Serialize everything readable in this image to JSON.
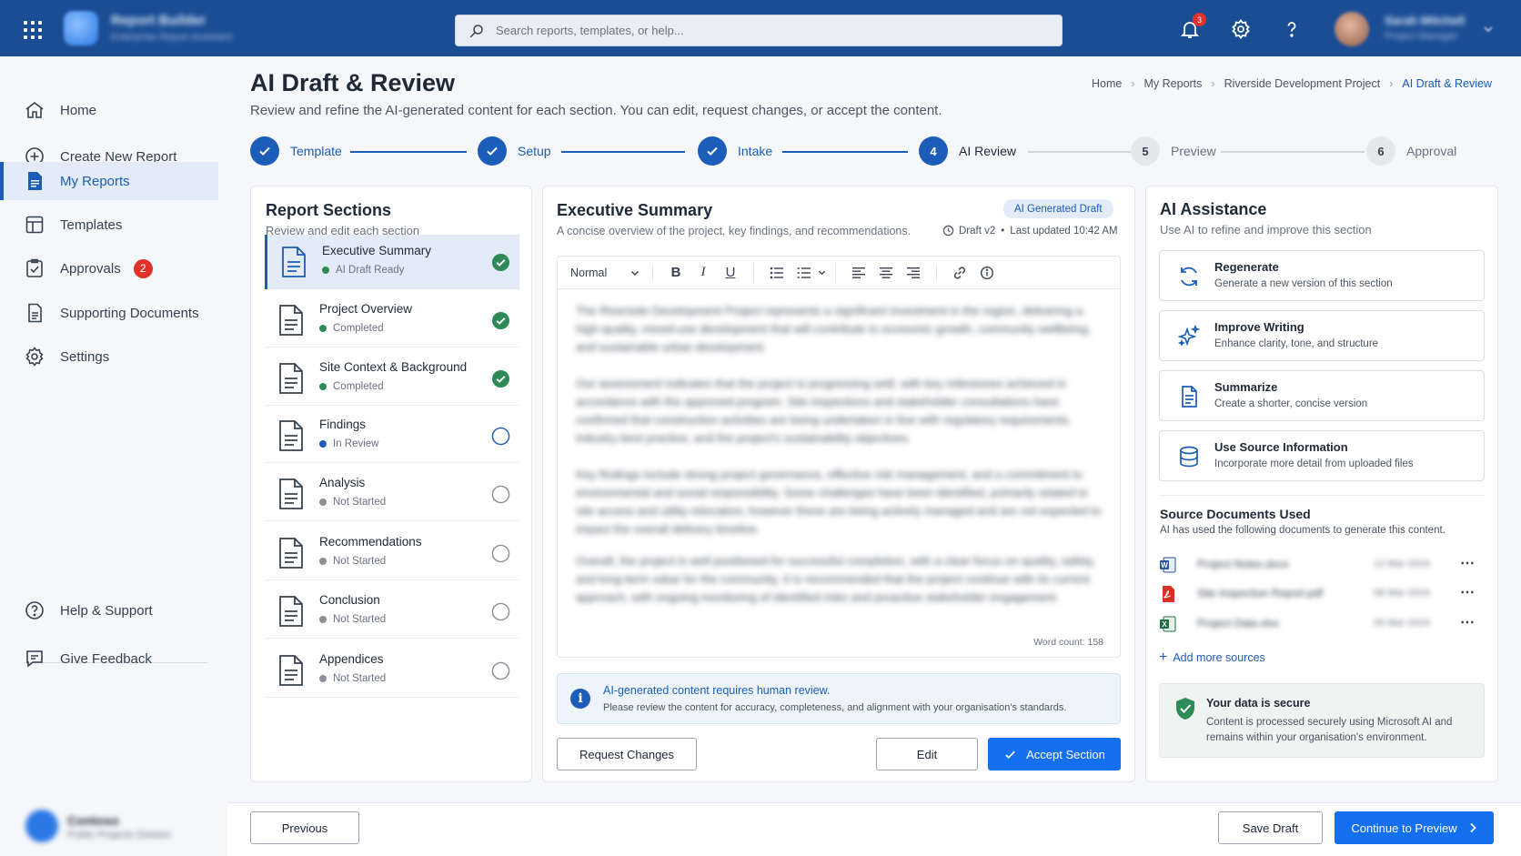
{
  "topbar": {
    "brand_title": "Report Builder",
    "brand_subtitle": "Enterprise Report Assistant",
    "search_placeholder": "Search reports, templates, or help...",
    "notification_count": "3",
    "user_name": "Sarah Mitchell",
    "user_role": "Project Manager"
  },
  "sidebar": {
    "items": [
      {
        "label": "Home",
        "icon": "home-icon"
      },
      {
        "label": "Create New Report",
        "icon": "plus-circle-icon"
      },
      {
        "label": "My Reports",
        "icon": "reports-icon"
      },
      {
        "label": "Templates",
        "icon": "templates-icon"
      },
      {
        "label": "Approvals",
        "icon": "approvals-icon",
        "badge": "2"
      },
      {
        "label": "Supporting Documents",
        "icon": "documents-icon"
      },
      {
        "label": "Settings",
        "icon": "gear-icon"
      }
    ],
    "bottom_items": [
      {
        "label": "Help & Support",
        "icon": "help-icon"
      },
      {
        "label": "Give Feedback",
        "icon": "feedback-icon"
      }
    ],
    "footer_name": "Contoso",
    "footer_sub": "Public Projects Division"
  },
  "header": {
    "title": "AI Draft & Review",
    "subtitle": "Review and refine the AI-generated content for each section. You can edit, request changes, or accept the content.",
    "breadcrumb": [
      "Home",
      "My Reports",
      "Riverside Development Project",
      "AI Draft & Review"
    ]
  },
  "stepper": [
    {
      "num": "1",
      "label": "Template",
      "state": "done"
    },
    {
      "num": "2",
      "label": "Setup",
      "state": "done"
    },
    {
      "num": "3",
      "label": "Intake",
      "state": "done"
    },
    {
      "num": "4",
      "label": "AI Review",
      "state": "current"
    },
    {
      "num": "5",
      "label": "Preview",
      "state": "todo"
    },
    {
      "num": "6",
      "label": "Approval",
      "state": "todo"
    }
  ],
  "sections_panel": {
    "title": "Report Sections",
    "subtitle": "Review and edit each section",
    "sections": [
      {
        "name": "Executive Summary",
        "status": "AI Draft Ready",
        "status_color": "#2e8b57",
        "checked": true
      },
      {
        "name": "Project Overview",
        "status": "Completed",
        "status_color": "#2e8b57",
        "checked": true
      },
      {
        "name": "Site Context & Background",
        "status": "Completed",
        "status_color": "#2e8b57",
        "checked": true
      },
      {
        "name": "Findings",
        "status": "In Review",
        "status_color": "#1b5db8",
        "checked": false
      },
      {
        "name": "Analysis",
        "status": "Not Started",
        "status_color": "#8a8f98",
        "checked": false
      },
      {
        "name": "Recommendations",
        "status": "Not Started",
        "status_color": "#8a8f98",
        "checked": false
      },
      {
        "name": "Conclusion",
        "status": "Not Started",
        "status_color": "#8a8f98",
        "checked": false
      },
      {
        "name": "Appendices",
        "status": "Not Started",
        "status_color": "#8a8f98",
        "checked": false
      }
    ]
  },
  "editor": {
    "title": "Executive Summary",
    "badge": "AI Generated Draft",
    "description": "A concise overview of the project, key findings, and recommendations.",
    "draft_version": "Draft v2",
    "last_updated": "Last updated 10:42 AM",
    "style_select": "Normal",
    "paragraphs": [
      "The Riverside Development Project represents a significant investment in the region, delivering a high-quality, mixed-use development that will contribute to economic growth, community wellbeing, and sustainable urban development.",
      "Our assessment indicates that the project is progressing well, with key milestones achieved in accordance with the approved program. Site inspections and stakeholder consultations have confirmed that construction activities are being undertaken in line with regulatory requirements, industry best practice, and the project's sustainability objectives.",
      "Key findings include strong project governance, effective risk management, and a commitment to environmental and social responsibility. Some challenges have been identified, primarily related to site access and utility relocation; however these are being actively managed and are not expected to impact the overall delivery timeline.",
      "Overall, the project is well positioned for successful completion, with a clear focus on quality, safety, and long-term value for the community. It is recommended that the project continue with its current approach, with ongoing monitoring of identified risks and proactive stakeholder engagement."
    ],
    "word_count": "Word count: 158",
    "notice_title": "AI-generated content requires human review.",
    "notice_text": "Please review the content for accuracy, completeness, and alignment with your organisation's standards.",
    "request_changes": "Request Changes",
    "edit": "Edit",
    "accept": "Accept Section"
  },
  "assist_panel": {
    "title": "AI Assistance",
    "subtitle": "Use AI to refine and improve this section",
    "actions": [
      {
        "title": "Regenerate",
        "desc": "Generate a new version of this section",
        "icon": "refresh-icon"
      },
      {
        "title": "Improve Writing",
        "desc": "Enhance clarity, tone, and structure",
        "icon": "sparkle-icon"
      },
      {
        "title": "Summarize",
        "desc": "Create a shorter, concise version",
        "icon": "document-icon"
      },
      {
        "title": "Use Source Information",
        "desc": "Incorporate more detail from uploaded files",
        "icon": "database-icon"
      }
    ],
    "sources_title": "Source Documents Used",
    "sources_subtitle": "AI has used the following documents to generate this content.",
    "sources": [
      {
        "name": "Project Notes.docx",
        "date": "12 Mar 2024",
        "type": "word",
        "color": "#2b579a"
      },
      {
        "name": "Site Inspection Report.pdf",
        "date": "08 Mar 2024",
        "type": "pdf",
        "color": "#d93025"
      },
      {
        "name": "Project Data.xlsx",
        "date": "05 Mar 2024",
        "type": "excel",
        "color": "#1e7145"
      }
    ],
    "add_sources": "Add more sources",
    "secure_title": "Your data is secure",
    "secure_text": "Content is processed securely using Microsoft AI and remains within your organisation's environment."
  },
  "footer": {
    "previous": "Previous",
    "save_draft": "Save Draft",
    "continue": "Continue to Preview"
  },
  "colors": {
    "topbar": "#1b4d94",
    "accent": "#1b5db8",
    "primary_button": "#1570ef",
    "success": "#2e8b57"
  }
}
